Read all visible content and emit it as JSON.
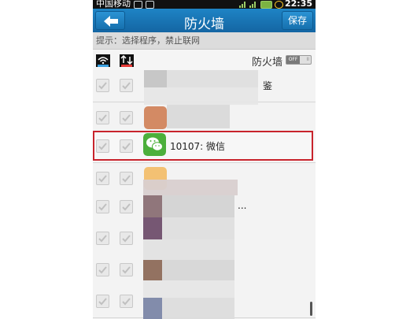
{
  "status_bar": {
    "carrier": "中国移动",
    "time": "22:35"
  },
  "header": {
    "title": "防火墙",
    "save_label": "保存"
  },
  "hint": "提示：选择程序，禁止联网",
  "list_header": {
    "wifi_icon_label": "WiFi",
    "data_icon_label": "2G/3G",
    "firewall_label": "防火墙",
    "toggle_off": "OFF",
    "toggle_on": "II"
  },
  "apps": [
    {
      "label": "鉴"
    },
    {
      "label": ""
    },
    {
      "label": "10107: 微信"
    },
    {
      "label": ""
    },
    {
      "label": "..."
    },
    {
      "label": ""
    },
    {
      "label": ""
    },
    {
      "label": ""
    }
  ],
  "colors": {
    "title_bar": "#1a78b8",
    "highlight": "#c8242c",
    "wechat_green": "#4caf3b"
  }
}
